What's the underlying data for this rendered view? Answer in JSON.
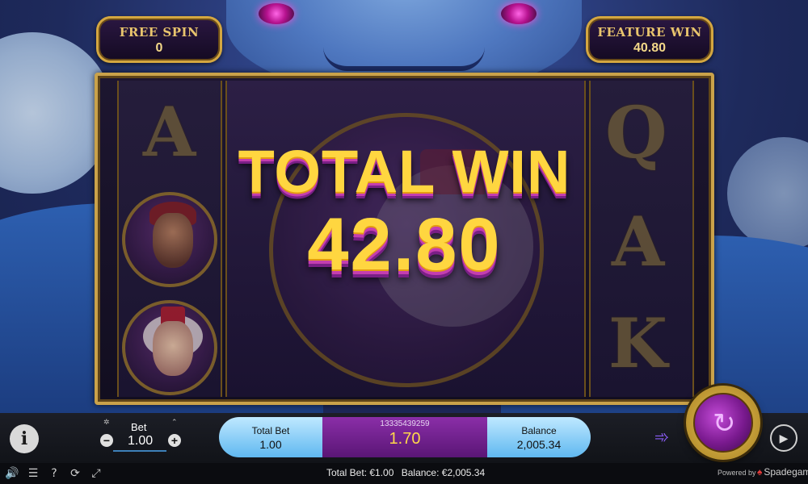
{
  "top_plaques": {
    "free_spin": {
      "label": "FREE SPIN",
      "value": "0"
    },
    "feature_win": {
      "label": "FEATURE WIN",
      "value": "40.80"
    }
  },
  "reels": {
    "left": [
      "A",
      "sultan-symbol",
      "monkey-symbol"
    ],
    "center": [
      "monkey-symbol-large"
    ],
    "right": [
      "Q",
      "A",
      "K"
    ]
  },
  "win_overlay": {
    "title": "TOTAL WIN",
    "amount": "42.80"
  },
  "controls": {
    "bet_label": "Bet",
    "bet_value": "1.00",
    "bet_minus": "−",
    "bet_plus": "+",
    "bet_min_marker": "✲",
    "bet_max_marker": "⌃",
    "info": "i"
  },
  "summary": {
    "total_bet_label": "Total Bet",
    "total_bet_value": "1.00",
    "round_id": "13335439259",
    "win_value": "1.70",
    "balance_label": "Balance",
    "balance_value": "2,005.34"
  },
  "status_bar": {
    "total_bet": "Total Bet: €1.00",
    "balance": "Balance: €2,005.34",
    "powered_by": "Powered by",
    "brand": "Spadegaming"
  },
  "icons": {
    "spin": "spin-icon",
    "turbo": "turbo-icon",
    "autoplay": "autoplay-icon",
    "sound": "sound-icon",
    "menu": "menu-icon",
    "help": "help-icon",
    "history": "history-icon",
    "fullscreen": "fullscreen-icon"
  },
  "colors": {
    "gold": "#d4a740",
    "win_text": "#ffd640",
    "summary_blue": "#5fb8f0",
    "summary_purple": "#8a2ea8"
  }
}
